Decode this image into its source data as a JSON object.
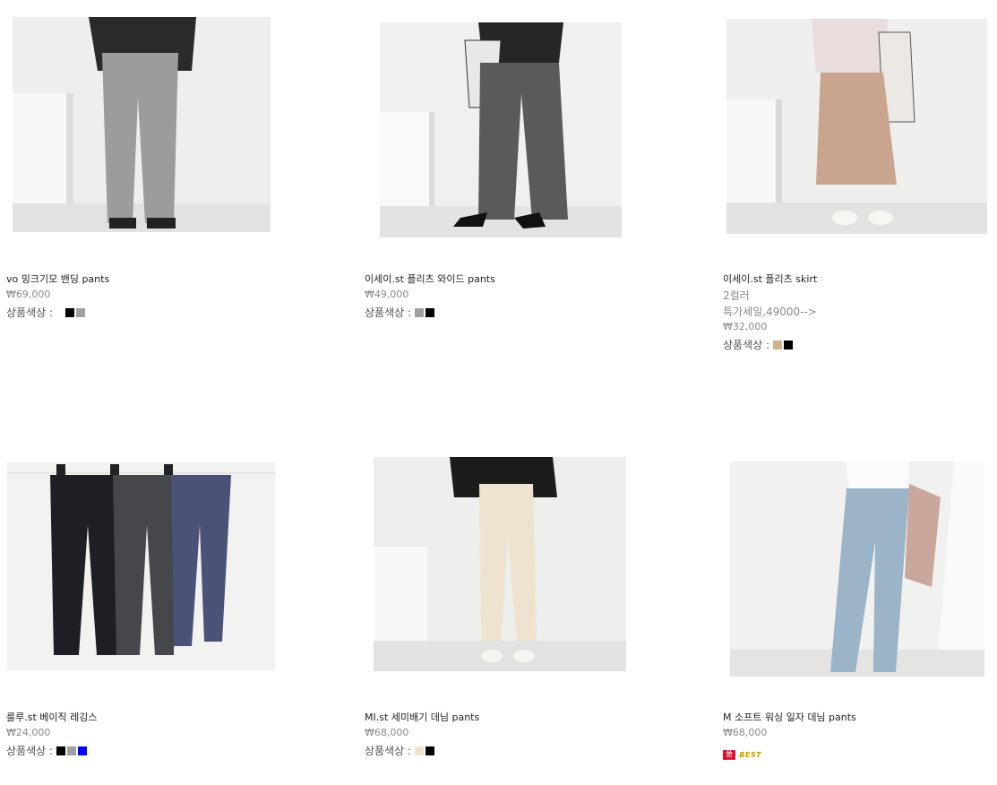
{
  "products": [
    {
      "name": "vo 밍크기모 밴딩 pants",
      "price": "₩69,000",
      "colors_label": "상품색상 :",
      "colors": [
        "#000000",
        "#a0a0a0"
      ]
    },
    {
      "name": "이세이.st 플리츠 와이드 pants",
      "price": "₩49,000",
      "colors_label": "상품색상 :",
      "colors": [
        "#a0a0a0",
        "#000000"
      ]
    },
    {
      "name": "이세이.st 플리츠 skirt",
      "extra1": "2컬러",
      "extra2": "특가세일,49000-->",
      "price": "₩32,000",
      "colors_label": "상품색상 :",
      "colors": [
        "#d2b48c",
        "#000000"
      ]
    },
    {
      "name": "룰루.st 베이직 레깅스",
      "price": "₩24,000",
      "colors_label": "상품색상 :",
      "colors": [
        "#000000",
        "#a0a0a0",
        "#0000ff"
      ]
    },
    {
      "name": "MI.st 세미배기 데님 pants",
      "price": "₩68,000",
      "colors_label": "상품색상 :",
      "colors": [
        "#efe4cc",
        "#000000"
      ]
    },
    {
      "name": "M 소프트 워싱 일자 데님 pants",
      "price": "₩68,000",
      "badges": {
        "soldout": "품절",
        "best": "BEST"
      }
    }
  ]
}
